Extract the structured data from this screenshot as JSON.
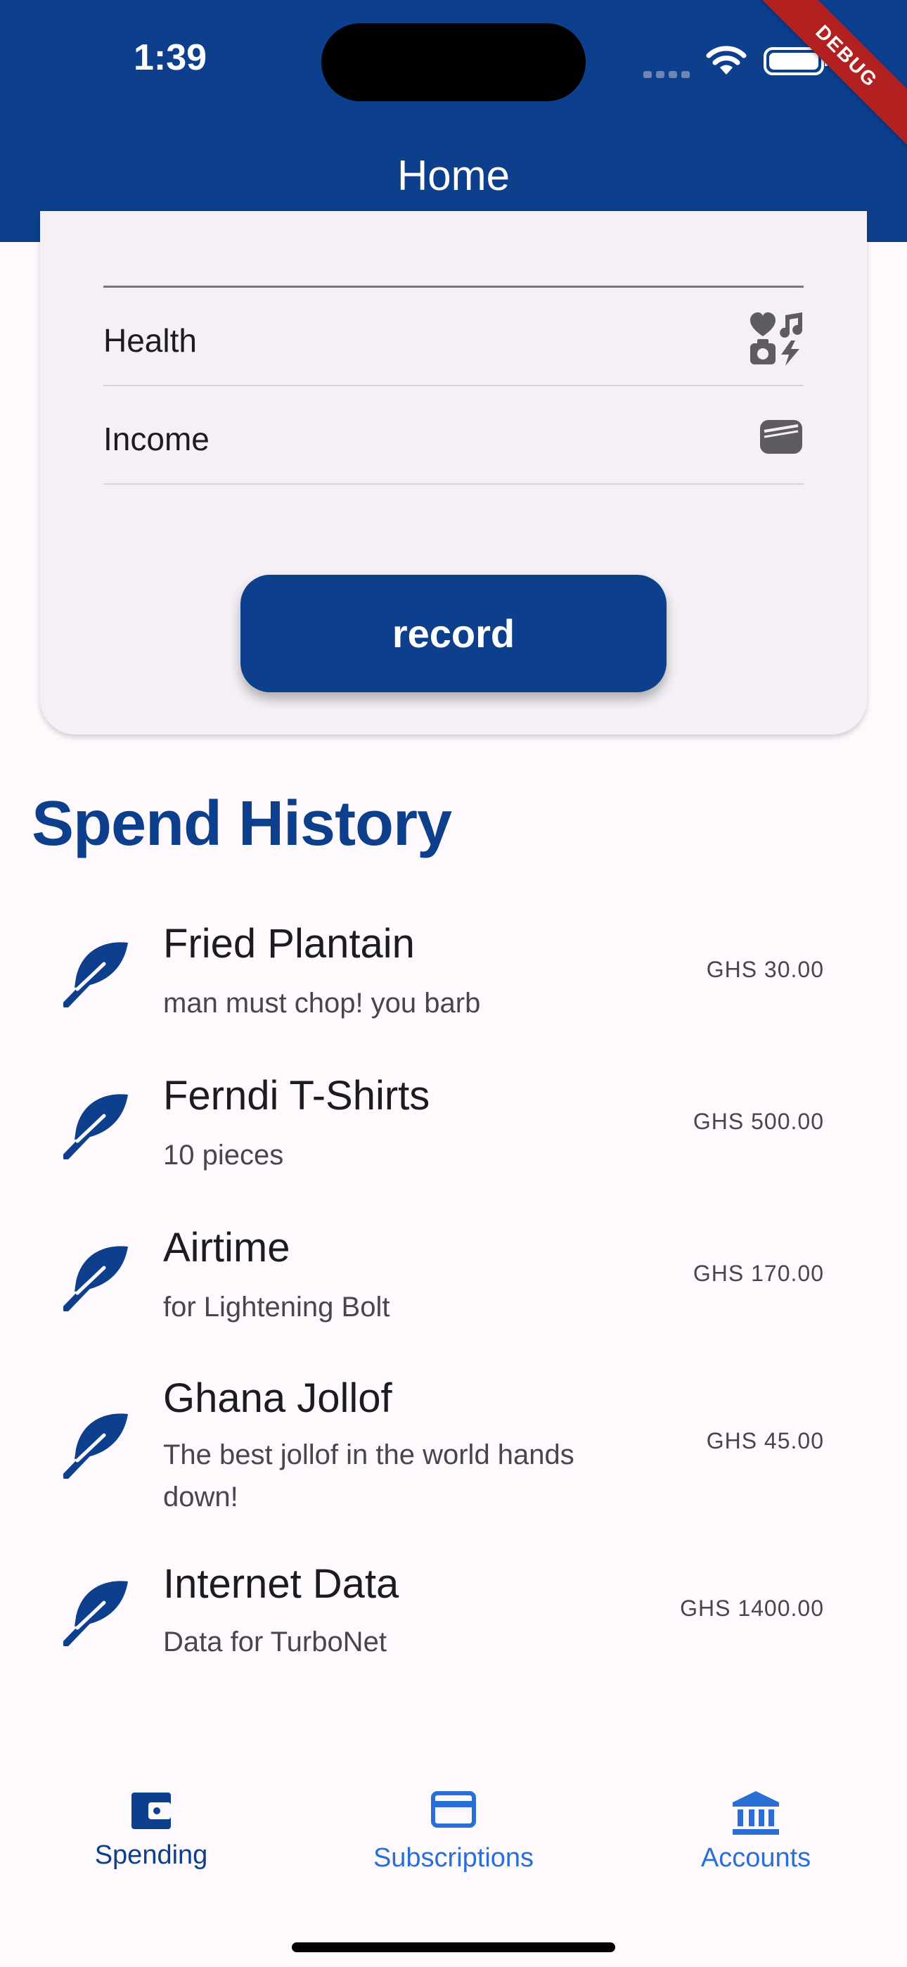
{
  "status_bar": {
    "time": "1:39",
    "debug_label": "DEBUG"
  },
  "app_bar": {
    "title": "Home"
  },
  "category_menu": {
    "items": [
      {
        "label": "Health",
        "icon": "emoji-symbols-icon"
      },
      {
        "label": "Income",
        "icon": "wallet-icon"
      }
    ]
  },
  "form": {
    "record_label": "record"
  },
  "history": {
    "title": "Spend History",
    "items": [
      {
        "title": "Fried Plantain",
        "subtitle": "man must chop! you barb",
        "amount": "GHS 30.00"
      },
      {
        "title": "Ferndi T-Shirts",
        "subtitle": "10 pieces",
        "amount": "GHS 500.00"
      },
      {
        "title": "Airtime",
        "subtitle": "for Lightening Bolt",
        "amount": "GHS 170.00"
      },
      {
        "title": "Ghana Jollof",
        "subtitle": "The best jollof in the world hands down!",
        "amount": "GHS 45.00"
      },
      {
        "title": "Internet Data",
        "subtitle": "Data for TurboNet",
        "amount": "GHS 1400.00"
      }
    ]
  },
  "bottom_nav": {
    "items": [
      {
        "label": "Spending",
        "active": true
      },
      {
        "label": "Subscriptions",
        "active": false
      },
      {
        "label": "Accounts",
        "active": false
      }
    ]
  },
  "colors": {
    "primary": "#0d3f8c",
    "nav_inactive": "#2a6fd6",
    "debug": "#b3201f"
  }
}
